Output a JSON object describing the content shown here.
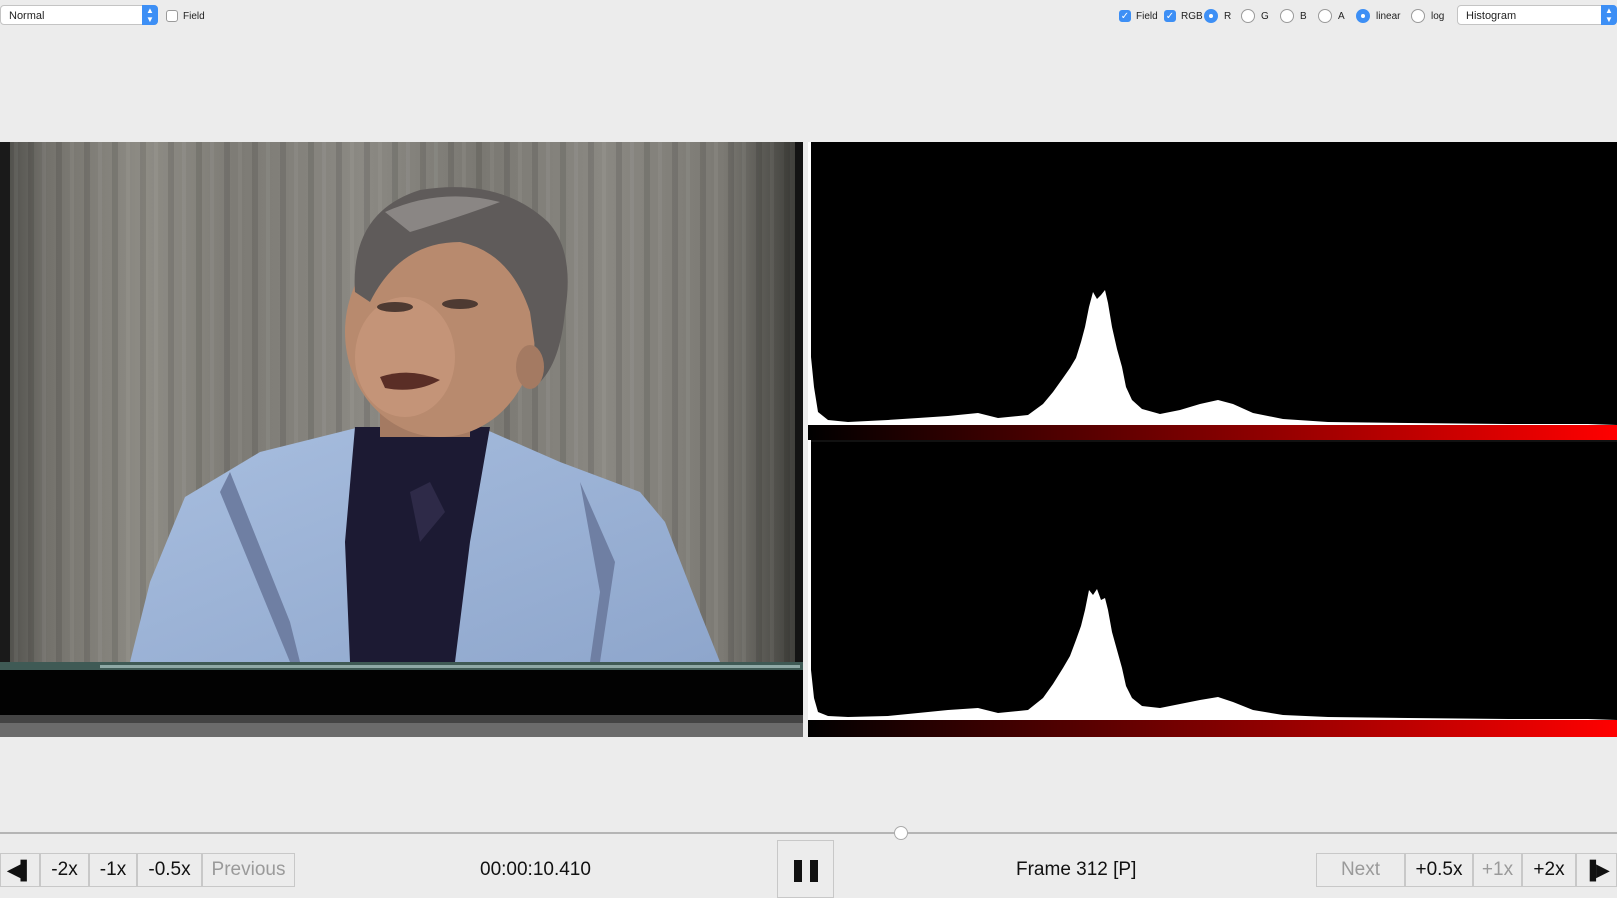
{
  "toolbar": {
    "mode_select": "Normal",
    "field_left_label": "Field",
    "field_right_label": "Field",
    "rgb_label": "RGB",
    "channels": [
      "R",
      "G",
      "B",
      "A"
    ],
    "selected_channel": "R",
    "scale_linear": "linear",
    "scale_log": "log",
    "selected_scale": "linear",
    "view_select": "Histogram"
  },
  "histogram": {
    "channel_color": "#ff0000",
    "panels": 2
  },
  "playback": {
    "timecode": "00:00:10.410",
    "frame": "Frame 312 [P]",
    "position_fraction": 0.557,
    "buttons": {
      "minus2": "-2x",
      "minus1": "-1x",
      "minus05": "-0.5x",
      "previous": "Previous",
      "next": "Next",
      "plus05": "+0.5x",
      "plus1": "+1x",
      "plus2": "+2x"
    }
  },
  "icons": {
    "step_back": "step-back-icon",
    "pause": "pause-icon",
    "step_forward": "step-forward-icon"
  }
}
